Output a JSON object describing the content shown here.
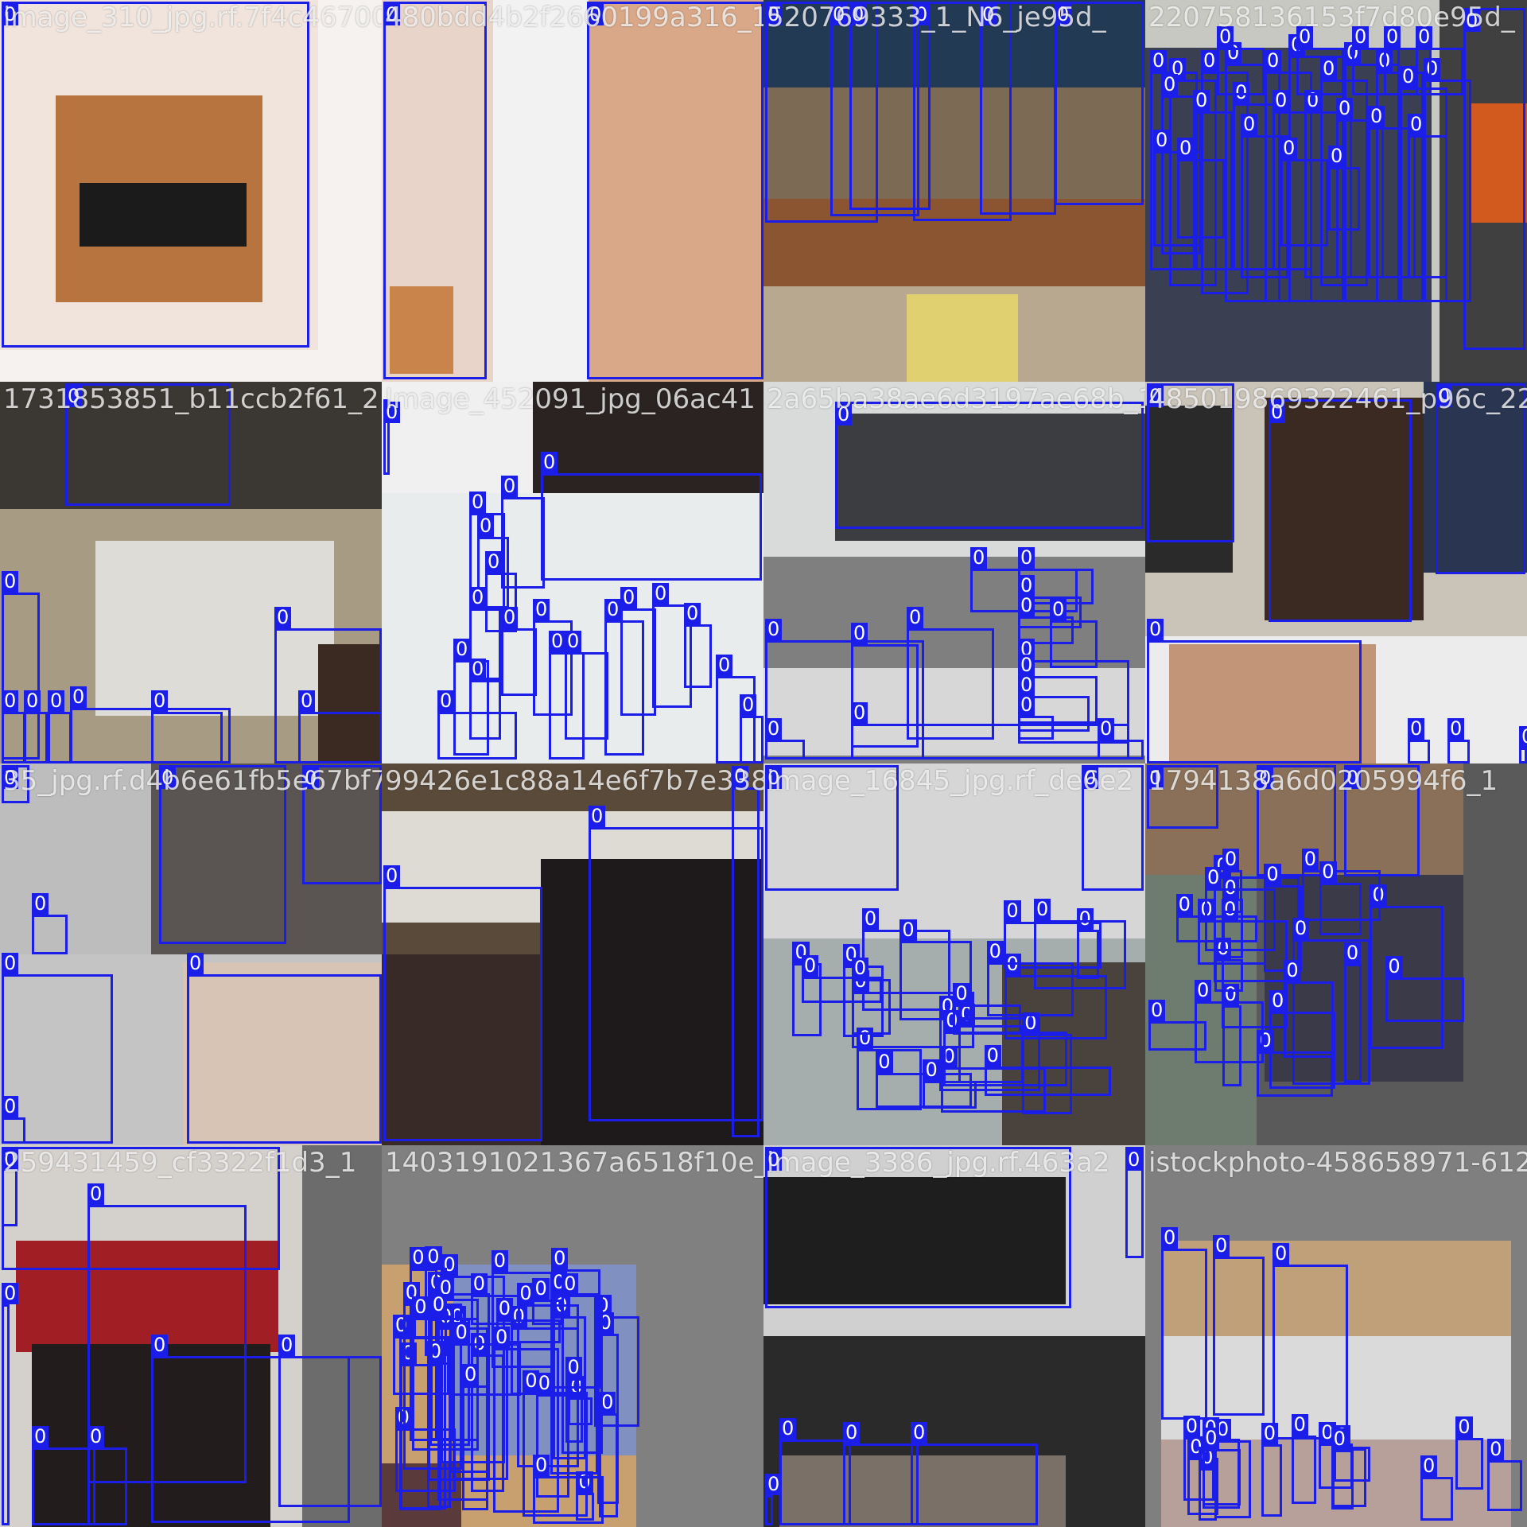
{
  "detection_class_label": "0",
  "colors": {
    "bbox": "#1a1ee8",
    "gray_fill": "#7f7f7f",
    "title": "#ffffff"
  },
  "tiles": [
    {
      "title": "image_310_jpg.rf.7f4c46700",
      "boxes": 1
    },
    {
      "title": "480bdd4b2f2660199a316_1",
      "boxes": 2
    },
    {
      "title": "520769333_1_N6_je95d_",
      "boxes": 6
    },
    {
      "title": "220758136153f7d80e95d_",
      "boxes": 30
    },
    {
      "title": "1731853851_b11ccb2f61_2",
      "boxes": 9
    },
    {
      "title": "Image_452091_jpg_06ac41",
      "boxes": 20
    },
    {
      "title": "2a65ba38ae6d3197ae68b_14",
      "boxes": 16
    },
    {
      "title": "485019869322461_p96c_22",
      "boxes": 7
    },
    {
      "title": "35_jpg.rf.d4b6e61fb5e67bf7",
      "boxes": 7
    },
    {
      "title": "99426e1c88a14e6f7b7e338b_2",
      "boxes": 3
    },
    {
      "title": "image_16845_jpg.rf_de6e2",
      "boxes": 24
    },
    {
      "title": "1794138a6d0205994f6_1",
      "boxes": 24
    },
    {
      "title": "259431459_cf3322f1d3_1",
      "boxes": 8
    },
    {
      "title": "1403191021367a6518f10e_1",
      "boxes": 40
    },
    {
      "title": "image_3386_jpg.rf.463a2",
      "boxes": 6
    },
    {
      "title": "istockphoto-458658971-612",
      "boxes": 18
    }
  ]
}
